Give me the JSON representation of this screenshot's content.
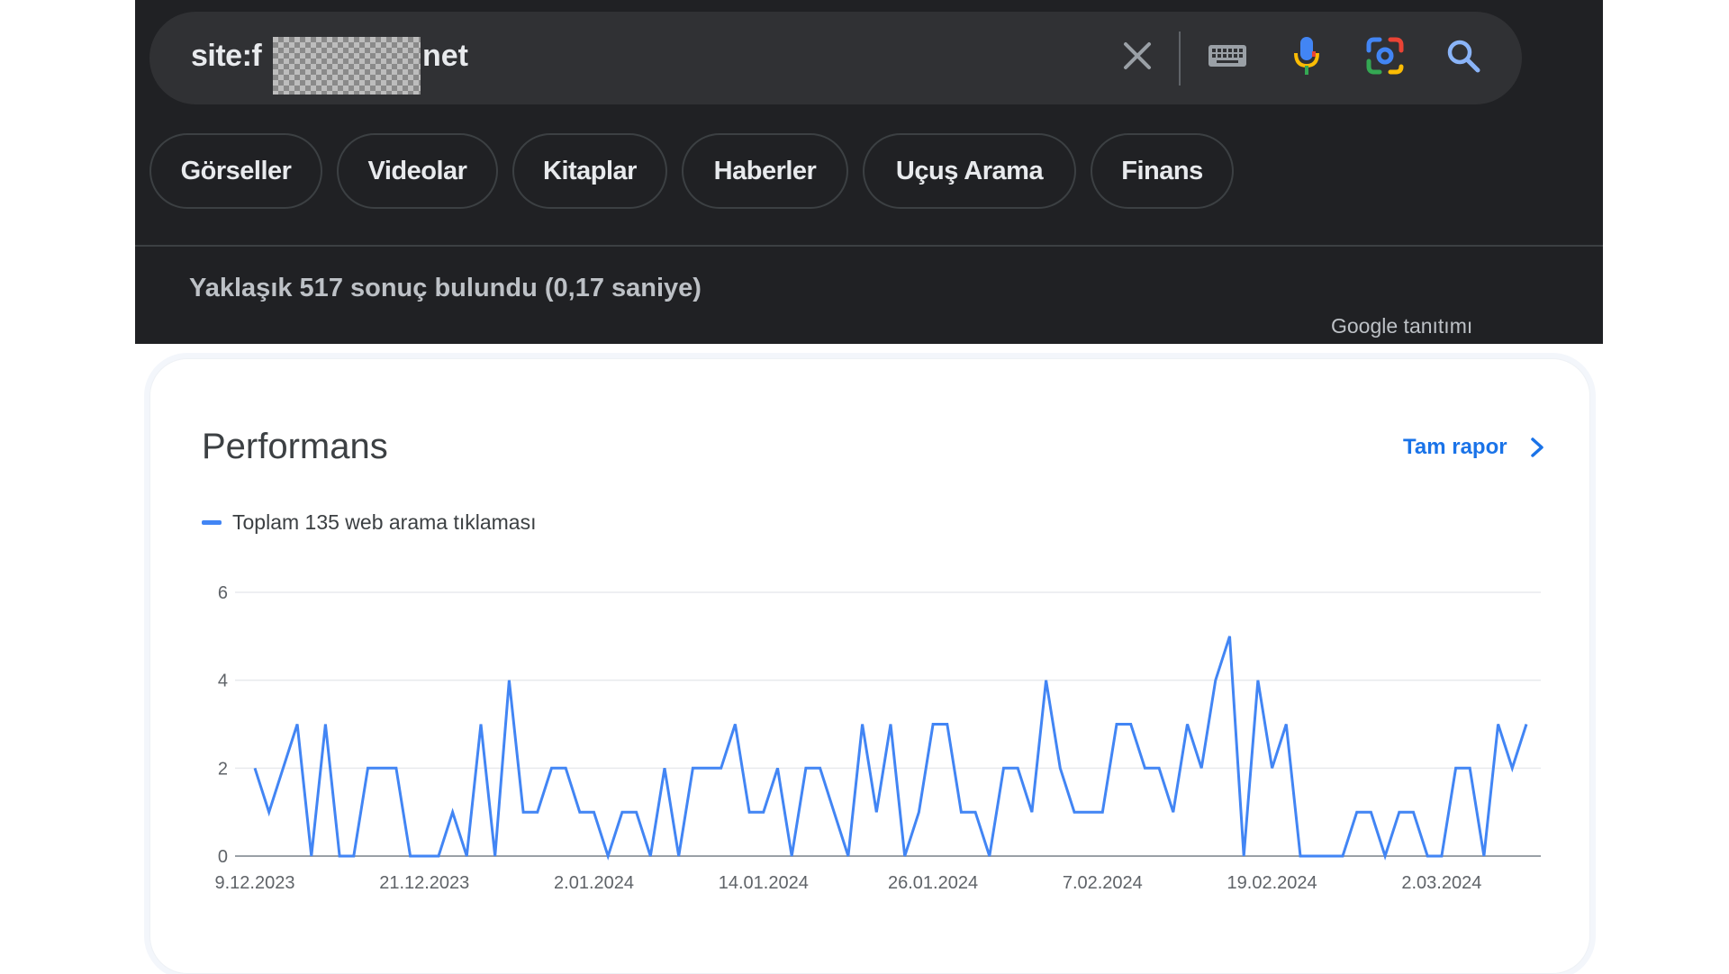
{
  "search": {
    "query_prefix": "site:f",
    "query_suffix": "net",
    "icons": [
      "close-icon",
      "keyboard-icon",
      "mic-icon",
      "lens-icon",
      "search-icon"
    ]
  },
  "chips": [
    "Görseller",
    "Videolar",
    "Kitaplar",
    "Haberler",
    "Uçuş Arama",
    "Finans"
  ],
  "result_stats": "Yaklaşık 517 sonuç bulundu (0,17 saniye)",
  "ad_label": "Google tanıtımı",
  "performance": {
    "title": "Performans",
    "full_report_label": "Tam rapor",
    "legend_label": "Toplam 135 web arama tıklaması"
  },
  "colors": {
    "line": "#4285f4",
    "link": "#1a73e8",
    "dark_bg": "#202124",
    "search_bg": "#303134"
  },
  "chart_data": {
    "type": "line",
    "title": "",
    "xlabel": "",
    "ylabel": "",
    "ylim": [
      0,
      6
    ],
    "yticks": [
      0,
      2,
      4,
      6
    ],
    "x_tick_labels": [
      "9.12.2023",
      "21.12.2023",
      "2.01.2024",
      "14.01.2024",
      "26.01.2024",
      "7.02.2024",
      "19.02.2024",
      "2.03.2024"
    ],
    "grid": true,
    "legend": "top-left",
    "series": [
      {
        "name": "Toplam 135 web arama tıklaması",
        "values": [
          2,
          1,
          2,
          3,
          0,
          3,
          0,
          0,
          2,
          2,
          2,
          0,
          0,
          0,
          1,
          0,
          3,
          0,
          4,
          1,
          1,
          2,
          2,
          1,
          1,
          0,
          1,
          1,
          0,
          2,
          0,
          2,
          2,
          2,
          3,
          1,
          1,
          2,
          0,
          2,
          2,
          1,
          0,
          3,
          1,
          3,
          0,
          1,
          3,
          3,
          1,
          1,
          0,
          2,
          2,
          1,
          4,
          2,
          1,
          1,
          1,
          3,
          3,
          2,
          2,
          1,
          3,
          2,
          4,
          5,
          0,
          4,
          2,
          3,
          0,
          0,
          0,
          0,
          1,
          1,
          0,
          1,
          1,
          0,
          0,
          2,
          2,
          0,
          3,
          2,
          3
        ]
      }
    ]
  }
}
